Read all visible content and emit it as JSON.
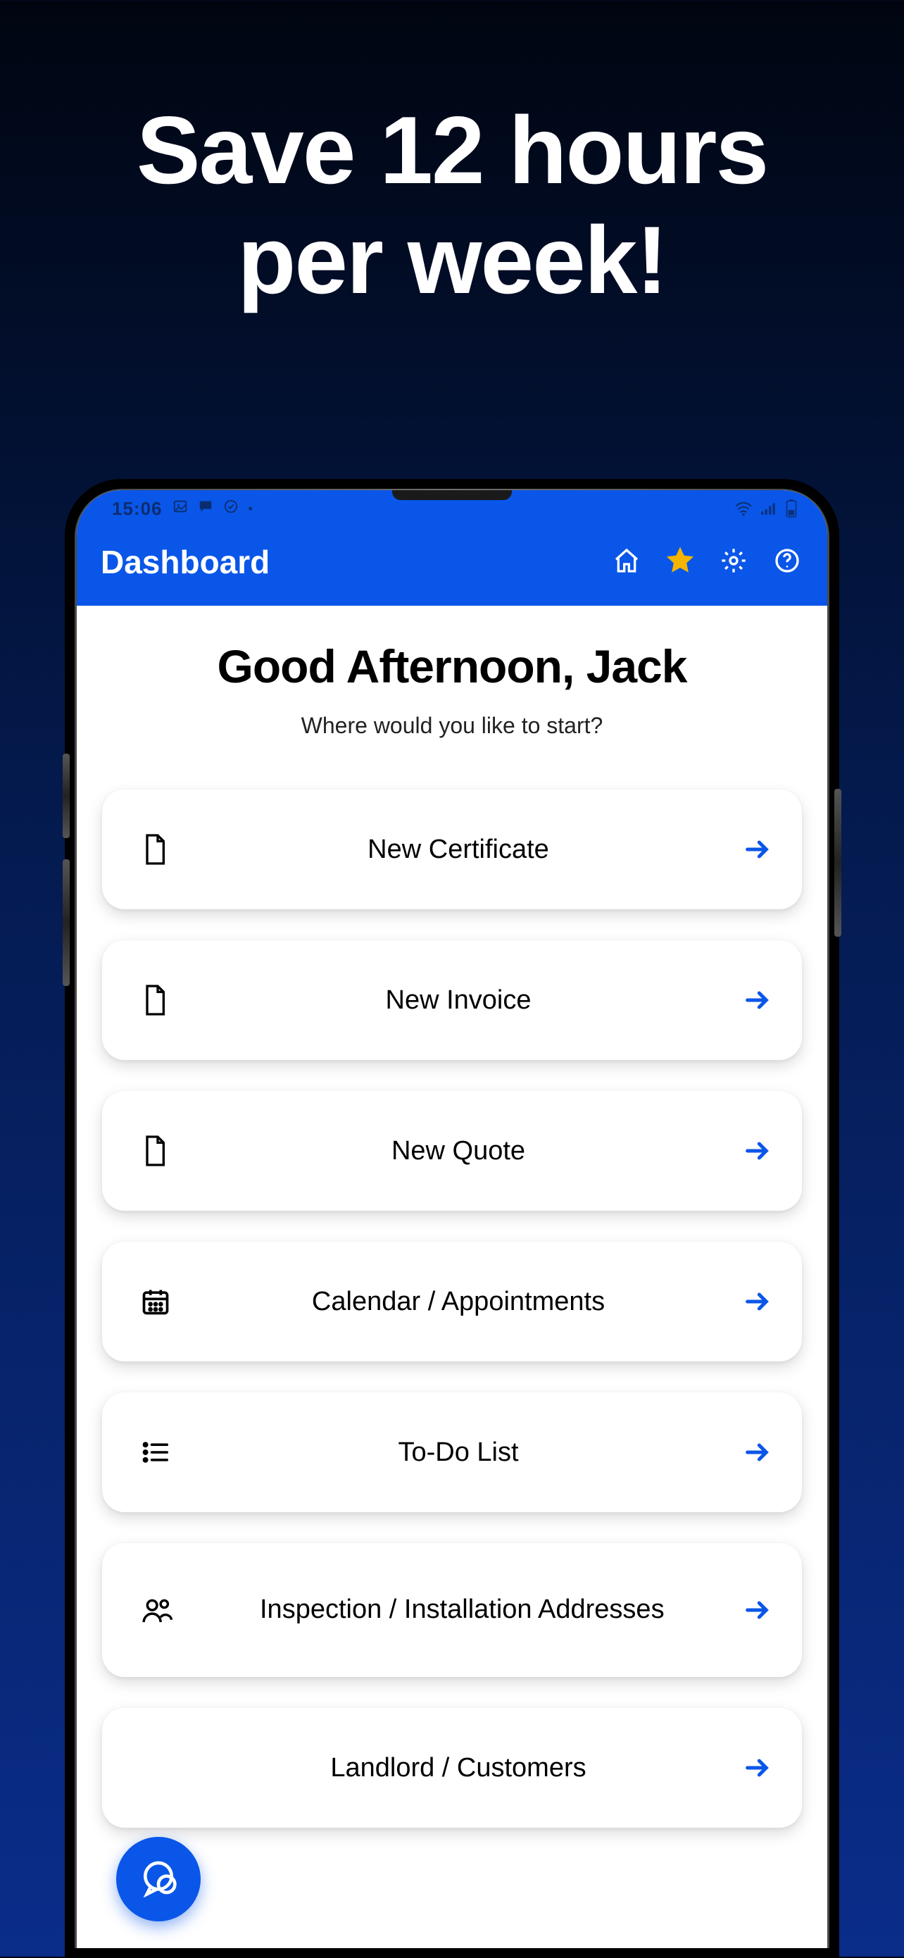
{
  "marketing": {
    "headline_line1": "Save 12 hours",
    "headline_line2": "per week!"
  },
  "status_bar": {
    "time": "15:06"
  },
  "header": {
    "title": "Dashboard"
  },
  "main": {
    "greeting": "Good Afternoon, Jack",
    "subtitle": "Where would you like to start?",
    "cards": [
      {
        "label": "New Certificate",
        "icon": "document"
      },
      {
        "label": "New Invoice",
        "icon": "document"
      },
      {
        "label": "New Quote",
        "icon": "document"
      },
      {
        "label": "Calendar / Appointments",
        "icon": "calendar"
      },
      {
        "label": "To-Do List",
        "icon": "list"
      },
      {
        "label": "Inspection / Installation Addresses",
        "icon": "people",
        "multiline": true
      },
      {
        "label": "Landlord / Customers",
        "icon": "blank"
      }
    ]
  },
  "colors": {
    "brand_blue": "#0a56e8",
    "star_gold": "#f5b400",
    "arrow_blue": "#0a56e8"
  }
}
